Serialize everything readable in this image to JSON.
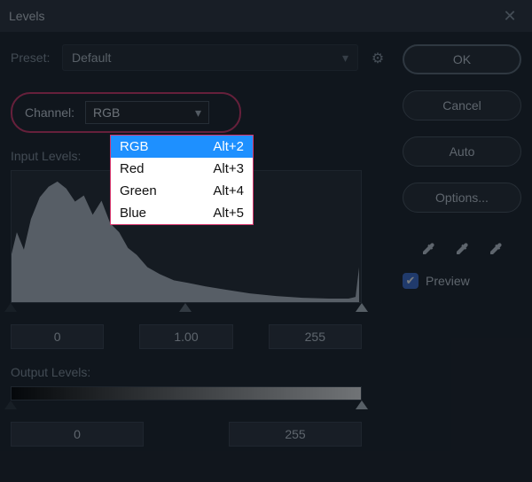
{
  "title": "Levels",
  "preset": {
    "label": "Preset:",
    "value": "Default"
  },
  "channel": {
    "label": "Channel:",
    "selected": "RGB",
    "options": [
      {
        "label": "RGB",
        "shortcut": "Alt+2",
        "selected": true
      },
      {
        "label": "Red",
        "shortcut": "Alt+3",
        "selected": false
      },
      {
        "label": "Green",
        "shortcut": "Alt+4",
        "selected": false
      },
      {
        "label": "Blue",
        "shortcut": "Alt+5",
        "selected": false
      }
    ]
  },
  "input_levels": {
    "label": "Input Levels:",
    "shadow": "0",
    "mid": "1.00",
    "highlight": "255"
  },
  "output_levels": {
    "label": "Output Levels:",
    "low": "0",
    "high": "255"
  },
  "buttons": {
    "ok": "OK",
    "cancel": "Cancel",
    "auto": "Auto",
    "options": "Options..."
  },
  "preview": {
    "label": "Preview",
    "checked": true
  }
}
